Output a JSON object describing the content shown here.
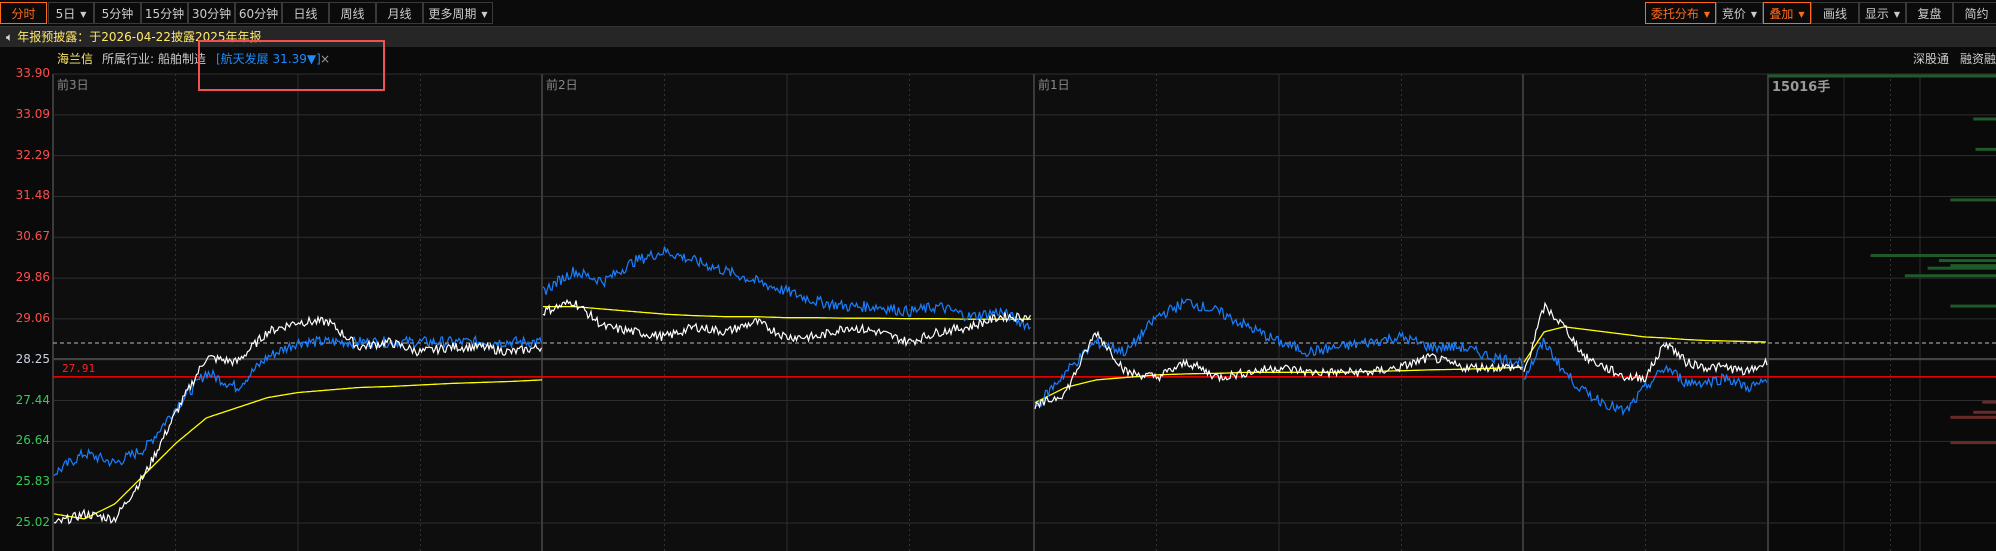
{
  "toolbar": {
    "left": [
      {
        "label": "分时",
        "active": true
      },
      {
        "label": "5日",
        "caret": true
      },
      {
        "label": "5分钟"
      },
      {
        "label": "15分钟"
      },
      {
        "label": "30分钟"
      },
      {
        "label": "60分钟"
      },
      {
        "label": "日线"
      },
      {
        "label": "周线"
      },
      {
        "label": "月线"
      },
      {
        "label": "更多周期",
        "caret": true
      }
    ],
    "right": [
      {
        "label": "委托分布",
        "caret": true,
        "active": true
      },
      {
        "label": "竞价",
        "caret": true
      },
      {
        "label": "叠加",
        "caret": true,
        "active": true
      },
      {
        "label": "画线"
      },
      {
        "label": "显示",
        "caret": true
      },
      {
        "label": "复盘"
      },
      {
        "label": "简约"
      }
    ]
  },
  "notice": {
    "icon": "speaker-icon",
    "text": "年报预披露：于2026-04-22披露2025年年报"
  },
  "info": {
    "stock_name": "海兰信",
    "industry_label": "所属行业:",
    "industry": "船舶制造",
    "overlay": "[航天发展 31.39▼]",
    "close": "×",
    "right_links": [
      "深股通",
      "融资融"
    ]
  },
  "chart": {
    "y_labels": [
      "33.90",
      "33.09",
      "32.29",
      "31.48",
      "30.67",
      "29.86",
      "29.06",
      "28.25",
      "27.44",
      "26.64",
      "25.83",
      "25.02"
    ],
    "day_labels": [
      "前3日",
      "前2日",
      "前1日"
    ],
    "prev_close_label": "27.91",
    "volume_label": "15016手",
    "colors": {
      "up": "#ff4d4d",
      "down": "#33cc55",
      "neutral": "#c8d0e0",
      "price": "#ffffff",
      "overlay": "#1a7fff",
      "avg": "#ffff00",
      "prev_close": "#ff0000"
    }
  },
  "chart_data": {
    "type": "line",
    "ylim": [
      25.02,
      33.9
    ],
    "prev_close": 27.91,
    "days": [
      {
        "white": [
          25.0,
          25.2,
          25.1,
          26.0,
          27.2,
          28.3,
          28.2,
          28.8,
          29.0,
          29.0,
          28.5,
          28.6,
          28.4,
          28.5,
          28.5,
          28.4,
          28.5
        ],
        "blue": [
          26.0,
          26.4,
          26.2,
          26.5,
          27.3,
          28.0,
          27.7,
          28.3,
          28.6,
          28.6,
          28.6,
          28.6,
          28.6,
          28.6,
          28.6,
          28.6,
          28.6
        ],
        "avg": [
          25.2,
          25.1,
          25.4,
          26.0,
          26.6,
          27.1,
          27.3,
          27.5,
          27.6,
          27.65,
          27.7,
          27.72,
          27.75,
          27.78,
          27.8,
          27.82,
          27.85
        ]
      },
      {
        "white": [
          29.2,
          29.4,
          28.9,
          28.8,
          28.7,
          28.9,
          28.8,
          29.0,
          28.7,
          28.7,
          28.9,
          28.8,
          28.6,
          28.8,
          28.9,
          29.1,
          29.1
        ],
        "blue": [
          29.6,
          30.0,
          29.8,
          30.2,
          30.4,
          30.2,
          30.0,
          29.8,
          29.6,
          29.4,
          29.3,
          29.3,
          29.2,
          29.3,
          29.1,
          29.2,
          28.9
        ],
        "avg": [
          29.3,
          29.3,
          29.25,
          29.2,
          29.15,
          29.12,
          29.1,
          29.1,
          29.08,
          29.08,
          29.07,
          29.07,
          29.06,
          29.06,
          29.05,
          29.05,
          29.05
        ]
      },
      {
        "white": [
          27.3,
          27.6,
          28.8,
          28.0,
          27.9,
          28.2,
          27.9,
          28.0,
          28.1,
          28.0,
          28.0,
          28.0,
          28.1,
          28.3,
          28.1,
          28.1,
          28.1
        ],
        "blue": [
          27.3,
          28.0,
          28.6,
          28.4,
          29.1,
          29.4,
          29.2,
          28.9,
          28.6,
          28.4,
          28.5,
          28.6,
          28.7,
          28.5,
          28.5,
          28.3,
          28.2
        ],
        "avg": [
          27.4,
          27.7,
          27.85,
          27.9,
          27.95,
          27.97,
          27.98,
          28.0,
          28.0,
          28.0,
          28.0,
          28.02,
          28.03,
          28.05,
          28.06,
          28.08,
          28.1
        ]
      },
      {
        "white": [
          28.0,
          29.3,
          28.9,
          28.3,
          28.1,
          27.9,
          27.9,
          28.6,
          28.2,
          28.1,
          28.1,
          28.0,
          28.2
        ],
        "blue": [
          27.9,
          28.6,
          28.0,
          27.6,
          27.4,
          27.2,
          27.7,
          28.1,
          27.8,
          27.8,
          27.9,
          27.7,
          27.8
        ],
        "avg": [
          28.2,
          28.8,
          28.9,
          28.85,
          28.8,
          28.75,
          28.7,
          28.68,
          28.65,
          28.63,
          28.62,
          28.61,
          28.6
        ]
      }
    ],
    "orderbook": {
      "buy": [
        [
          33.85,
          1.0
        ],
        [
          33.0,
          0.1
        ],
        [
          32.4,
          0.09
        ],
        [
          31.4,
          0.2
        ],
        [
          30.3,
          0.55
        ],
        [
          30.2,
          0.25
        ],
        [
          30.1,
          0.2
        ],
        [
          30.05,
          0.3
        ],
        [
          29.9,
          0.4
        ],
        [
          29.3,
          0.2
        ]
      ],
      "sell": [
        [
          27.4,
          0.06
        ],
        [
          27.2,
          0.1
        ],
        [
          27.1,
          0.2
        ],
        [
          26.6,
          0.2
        ]
      ]
    }
  }
}
